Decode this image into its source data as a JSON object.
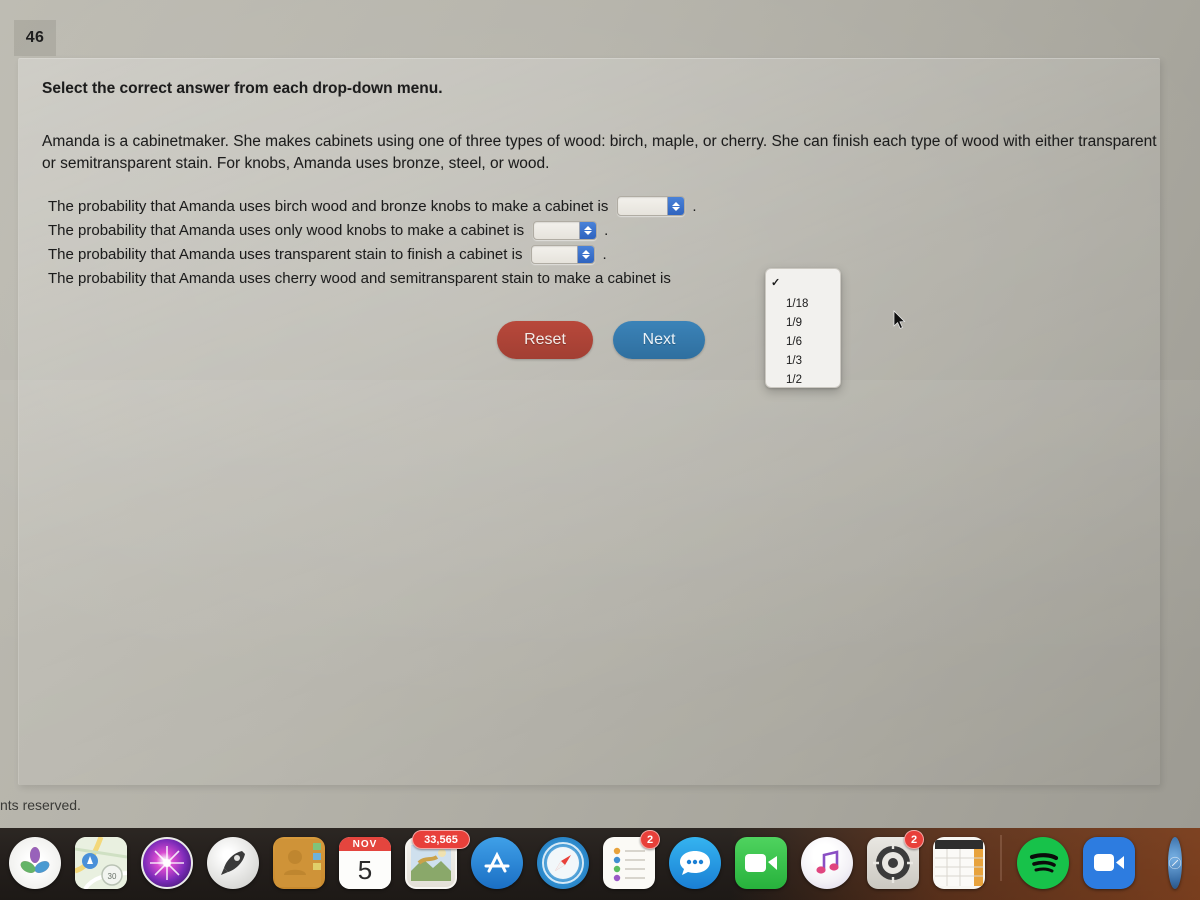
{
  "question": {
    "number": "46",
    "instruction": "Select the correct answer from each drop-down menu.",
    "passage": "Amanda is a cabinetmaker. She makes cabinets using one of three types of wood: birch, maple, or cherry. She can finish each type of wood with either transparent or semitransparent stain. For knobs, Amanda uses bronze, steel, or wood.",
    "statements": [
      {
        "text": "The probability that Amanda uses birch wood and bronze knobs to make a cabinet is",
        "value": "",
        "period": "."
      },
      {
        "text": "The probability that Amanda uses only wood knobs to make a cabinet is",
        "value": "",
        "period": "."
      },
      {
        "text": "The probability that Amanda uses transparent stain to finish a cabinet is",
        "value": "",
        "period": "."
      },
      {
        "text": "The probability that Amanda uses cherry wood and semitransparent stain to make a cabinet is",
        "value": "",
        "period": "."
      }
    ]
  },
  "dropdown": {
    "open": true,
    "selected": "",
    "options": [
      "",
      "1/18",
      "1/9",
      "1/6",
      "1/3",
      "1/2"
    ]
  },
  "buttons": {
    "reset_label": "Reset",
    "next_label": "Next",
    "reset_color": "#a23f33",
    "next_color": "#2f6f9f"
  },
  "footer": {
    "text": "nts reserved."
  },
  "dock": {
    "items": [
      {
        "name": "photos",
        "label": "Photos",
        "badge": ""
      },
      {
        "name": "maps",
        "label": "Maps",
        "badge": ""
      },
      {
        "name": "siri",
        "label": "Siri",
        "badge": ""
      },
      {
        "name": "launchpad",
        "label": "Launchpad",
        "badge": ""
      },
      {
        "name": "contacts",
        "label": "Contacts",
        "badge": ""
      },
      {
        "name": "calendar",
        "label": "Calendar",
        "badge": "",
        "month": "NOV",
        "day": "5"
      },
      {
        "name": "mail",
        "label": "Mail",
        "badge": "33,565"
      },
      {
        "name": "app-store",
        "label": "App Store",
        "badge": ""
      },
      {
        "name": "safari",
        "label": "Safari",
        "badge": ""
      },
      {
        "name": "reminders",
        "label": "Reminders",
        "badge": "2"
      },
      {
        "name": "messages",
        "label": "Messages",
        "badge": ""
      },
      {
        "name": "facetime",
        "label": "FaceTime",
        "badge": ""
      },
      {
        "name": "music",
        "label": "Music",
        "badge": ""
      },
      {
        "name": "system-preferences",
        "label": "System Preferences",
        "badge": "2"
      },
      {
        "name": "numbers",
        "label": "Numbers",
        "badge": ""
      },
      {
        "name": "separator",
        "label": "",
        "badge": ""
      },
      {
        "name": "spotify",
        "label": "Spotify",
        "badge": ""
      },
      {
        "name": "zoom",
        "label": "Zoom",
        "badge": ""
      },
      {
        "name": "edge-app",
        "label": "",
        "badge": ""
      }
    ]
  }
}
